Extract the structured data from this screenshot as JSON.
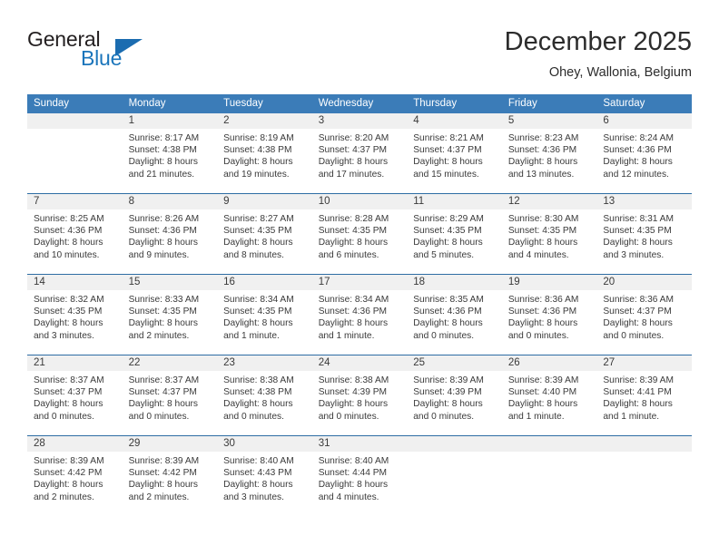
{
  "brand": {
    "name_part1": "General",
    "name_part2": "Blue",
    "logo_icon": "blue-triangle-icon"
  },
  "header": {
    "title": "December 2025",
    "subtitle": "Ohey, Wallonia, Belgium"
  },
  "colors": {
    "header_blue": "#3b7cb8",
    "separator_blue": "#2e6da4",
    "brand_blue": "#1b75bb",
    "day_band_gray": "#f0f0f0",
    "text": "#3a3a3a"
  },
  "weekdays": [
    "Sunday",
    "Monday",
    "Tuesday",
    "Wednesday",
    "Thursday",
    "Friday",
    "Saturday"
  ],
  "weeks": [
    [
      {
        "day": "",
        "lines": []
      },
      {
        "day": "1",
        "lines": [
          "Sunrise: 8:17 AM",
          "Sunset: 4:38 PM",
          "Daylight: 8 hours",
          "and 21 minutes."
        ]
      },
      {
        "day": "2",
        "lines": [
          "Sunrise: 8:19 AM",
          "Sunset: 4:38 PM",
          "Daylight: 8 hours",
          "and 19 minutes."
        ]
      },
      {
        "day": "3",
        "lines": [
          "Sunrise: 8:20 AM",
          "Sunset: 4:37 PM",
          "Daylight: 8 hours",
          "and 17 minutes."
        ]
      },
      {
        "day": "4",
        "lines": [
          "Sunrise: 8:21 AM",
          "Sunset: 4:37 PM",
          "Daylight: 8 hours",
          "and 15 minutes."
        ]
      },
      {
        "day": "5",
        "lines": [
          "Sunrise: 8:23 AM",
          "Sunset: 4:36 PM",
          "Daylight: 8 hours",
          "and 13 minutes."
        ]
      },
      {
        "day": "6",
        "lines": [
          "Sunrise: 8:24 AM",
          "Sunset: 4:36 PM",
          "Daylight: 8 hours",
          "and 12 minutes."
        ]
      }
    ],
    [
      {
        "day": "7",
        "lines": [
          "Sunrise: 8:25 AM",
          "Sunset: 4:36 PM",
          "Daylight: 8 hours",
          "and 10 minutes."
        ]
      },
      {
        "day": "8",
        "lines": [
          "Sunrise: 8:26 AM",
          "Sunset: 4:36 PM",
          "Daylight: 8 hours",
          "and 9 minutes."
        ]
      },
      {
        "day": "9",
        "lines": [
          "Sunrise: 8:27 AM",
          "Sunset: 4:35 PM",
          "Daylight: 8 hours",
          "and 8 minutes."
        ]
      },
      {
        "day": "10",
        "lines": [
          "Sunrise: 8:28 AM",
          "Sunset: 4:35 PM",
          "Daylight: 8 hours",
          "and 6 minutes."
        ]
      },
      {
        "day": "11",
        "lines": [
          "Sunrise: 8:29 AM",
          "Sunset: 4:35 PM",
          "Daylight: 8 hours",
          "and 5 minutes."
        ]
      },
      {
        "day": "12",
        "lines": [
          "Sunrise: 8:30 AM",
          "Sunset: 4:35 PM",
          "Daylight: 8 hours",
          "and 4 minutes."
        ]
      },
      {
        "day": "13",
        "lines": [
          "Sunrise: 8:31 AM",
          "Sunset: 4:35 PM",
          "Daylight: 8 hours",
          "and 3 minutes."
        ]
      }
    ],
    [
      {
        "day": "14",
        "lines": [
          "Sunrise: 8:32 AM",
          "Sunset: 4:35 PM",
          "Daylight: 8 hours",
          "and 3 minutes."
        ]
      },
      {
        "day": "15",
        "lines": [
          "Sunrise: 8:33 AM",
          "Sunset: 4:35 PM",
          "Daylight: 8 hours",
          "and 2 minutes."
        ]
      },
      {
        "day": "16",
        "lines": [
          "Sunrise: 8:34 AM",
          "Sunset: 4:35 PM",
          "Daylight: 8 hours",
          "and 1 minute."
        ]
      },
      {
        "day": "17",
        "lines": [
          "Sunrise: 8:34 AM",
          "Sunset: 4:36 PM",
          "Daylight: 8 hours",
          "and 1 minute."
        ]
      },
      {
        "day": "18",
        "lines": [
          "Sunrise: 8:35 AM",
          "Sunset: 4:36 PM",
          "Daylight: 8 hours",
          "and 0 minutes."
        ]
      },
      {
        "day": "19",
        "lines": [
          "Sunrise: 8:36 AM",
          "Sunset: 4:36 PM",
          "Daylight: 8 hours",
          "and 0 minutes."
        ]
      },
      {
        "day": "20",
        "lines": [
          "Sunrise: 8:36 AM",
          "Sunset: 4:37 PM",
          "Daylight: 8 hours",
          "and 0 minutes."
        ]
      }
    ],
    [
      {
        "day": "21",
        "lines": [
          "Sunrise: 8:37 AM",
          "Sunset: 4:37 PM",
          "Daylight: 8 hours",
          "and 0 minutes."
        ]
      },
      {
        "day": "22",
        "lines": [
          "Sunrise: 8:37 AM",
          "Sunset: 4:37 PM",
          "Daylight: 8 hours",
          "and 0 minutes."
        ]
      },
      {
        "day": "23",
        "lines": [
          "Sunrise: 8:38 AM",
          "Sunset: 4:38 PM",
          "Daylight: 8 hours",
          "and 0 minutes."
        ]
      },
      {
        "day": "24",
        "lines": [
          "Sunrise: 8:38 AM",
          "Sunset: 4:39 PM",
          "Daylight: 8 hours",
          "and 0 minutes."
        ]
      },
      {
        "day": "25",
        "lines": [
          "Sunrise: 8:39 AM",
          "Sunset: 4:39 PM",
          "Daylight: 8 hours",
          "and 0 minutes."
        ]
      },
      {
        "day": "26",
        "lines": [
          "Sunrise: 8:39 AM",
          "Sunset: 4:40 PM",
          "Daylight: 8 hours",
          "and 1 minute."
        ]
      },
      {
        "day": "27",
        "lines": [
          "Sunrise: 8:39 AM",
          "Sunset: 4:41 PM",
          "Daylight: 8 hours",
          "and 1 minute."
        ]
      }
    ],
    [
      {
        "day": "28",
        "lines": [
          "Sunrise: 8:39 AM",
          "Sunset: 4:42 PM",
          "Daylight: 8 hours",
          "and 2 minutes."
        ]
      },
      {
        "day": "29",
        "lines": [
          "Sunrise: 8:39 AM",
          "Sunset: 4:42 PM",
          "Daylight: 8 hours",
          "and 2 minutes."
        ]
      },
      {
        "day": "30",
        "lines": [
          "Sunrise: 8:40 AM",
          "Sunset: 4:43 PM",
          "Daylight: 8 hours",
          "and 3 minutes."
        ]
      },
      {
        "day": "31",
        "lines": [
          "Sunrise: 8:40 AM",
          "Sunset: 4:44 PM",
          "Daylight: 8 hours",
          "and 4 minutes."
        ]
      },
      {
        "day": "",
        "lines": []
      },
      {
        "day": "",
        "lines": []
      },
      {
        "day": "",
        "lines": []
      }
    ]
  ]
}
